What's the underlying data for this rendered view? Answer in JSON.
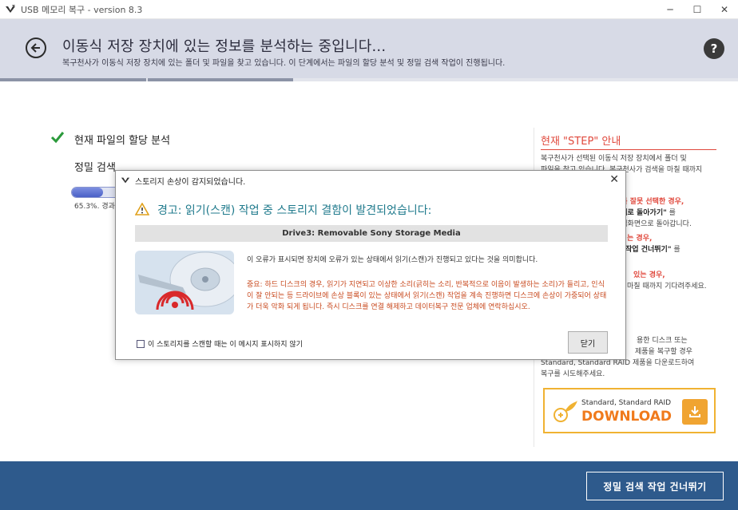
{
  "window": {
    "title": "USB 메모리 복구 - version 8.3",
    "controls": [
      "─",
      "☐",
      "✕"
    ]
  },
  "header": {
    "title": "이동식 저장 장치에 있는 정보를 분석하는 중입니다...",
    "subtitle": "복구천사가 이동식 저장 장치에 있는 폴더 및 파일을 찾고 있습니다. 이 단계에서는 파일의 할당 분석 및 정밀 검색 작업이 진행됩니다.",
    "help": "?"
  },
  "tasks": {
    "done_label": "현재 파일의 할당 분석",
    "current_label": "정밀 검색",
    "progress_fraction": 0.653,
    "progress_text": "65.3%. 경과"
  },
  "right_panel": {
    "title": "현재 \"STEP\" 안내",
    "p1_line1": "복구천사가 선택된 이동식 저장 장치에서 폴더 및",
    "p1_line2": "파일을 찾고 있습니다. 복구천사가 검색을 마칠 때까지",
    "p2_line1_red": "치를 잘못 선택한 경우,",
    "p2_line2_bold": "단계로 돌아가기\"",
    "p2_line2_rest": " 를",
    "p2_line3": "선택화면으로 돌아갑니다.",
    "p3_line1_red": "는 경우,",
    "p3_line2_bold": "작업 건너뛰기\"",
    "p3_line2_rest": " 를",
    "p4_line1_red": "있는 경우,",
    "p4_line2": "마칠 때까지 기다려주세요.",
    "p5_line1": "용한 디스크 또는",
    "p5_line2": "제품을 복구할 경우",
    "p5_line3": "Standard, Standard RAID 제품을 다운로드하여",
    "p5_line4": "복구를 시도해주세요."
  },
  "download": {
    "small": "Standard, Standard RAID",
    "big": "DOWNLOAD"
  },
  "footer": {
    "skip_label": "정밀 검색 작업 건너뛰기"
  },
  "dialog": {
    "title": "스토리지 손상이 감지되었습니다.",
    "close": "✕",
    "heading": "경고: 읽기(스캔) 작업 중 스토리지 결함이 발견되었습니다:",
    "drive": "Drive3: Removable Sony Storage Media",
    "message": "이 오류가 표시되면 장치에 오류가 있는 상태에서 읽기(스캔)가 진행되고 있다는 것을 의미합니다.",
    "warning": "중요: 하드 디스크의 경우, 읽기가 지연되고 이상한 소리(긁히는 소리, 반복적으로 이음이 발생하는 소리)가 들리고, 인식이 잘 안되는 등 드라이브에 손상 블록이 있는 상태에서 읽기(스캔) 작업을 계속 진행하면 디스크에 손상이 가중되어 상태가 더욱 악화 되게 됩니다. 즉시 디스크를 연결 해제하고 데이터복구 전문 업체에 연락하십시오.",
    "checkbox_label": "이 스토리지를 스캔할 때는 이 메시지 표시하지 않기",
    "checkbox_checked": false,
    "ok_label": "닫기"
  }
}
